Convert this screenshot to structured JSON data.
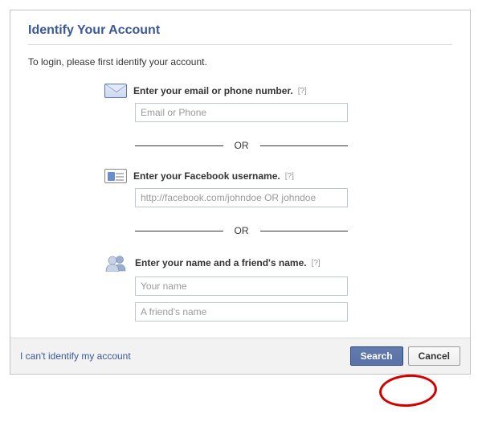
{
  "header": {
    "title": "Identify Your Account",
    "subtitle": "To login, please first identify your account."
  },
  "sections": {
    "email": {
      "label": "Enter your email or phone number.",
      "help": "[?]",
      "placeholder": "Email or Phone"
    },
    "username": {
      "label": "Enter your Facebook username.",
      "help": "[?]",
      "placeholder": "http://facebook.com/johndoe OR johndoe"
    },
    "names": {
      "label": "Enter your name and a friend's name.",
      "help": "[?]",
      "your_placeholder": "Your name",
      "friend_placeholder": "A friend's name"
    },
    "or": "OR"
  },
  "footer": {
    "cant_identify": "I can't identify my account",
    "search": "Search",
    "cancel": "Cancel"
  }
}
